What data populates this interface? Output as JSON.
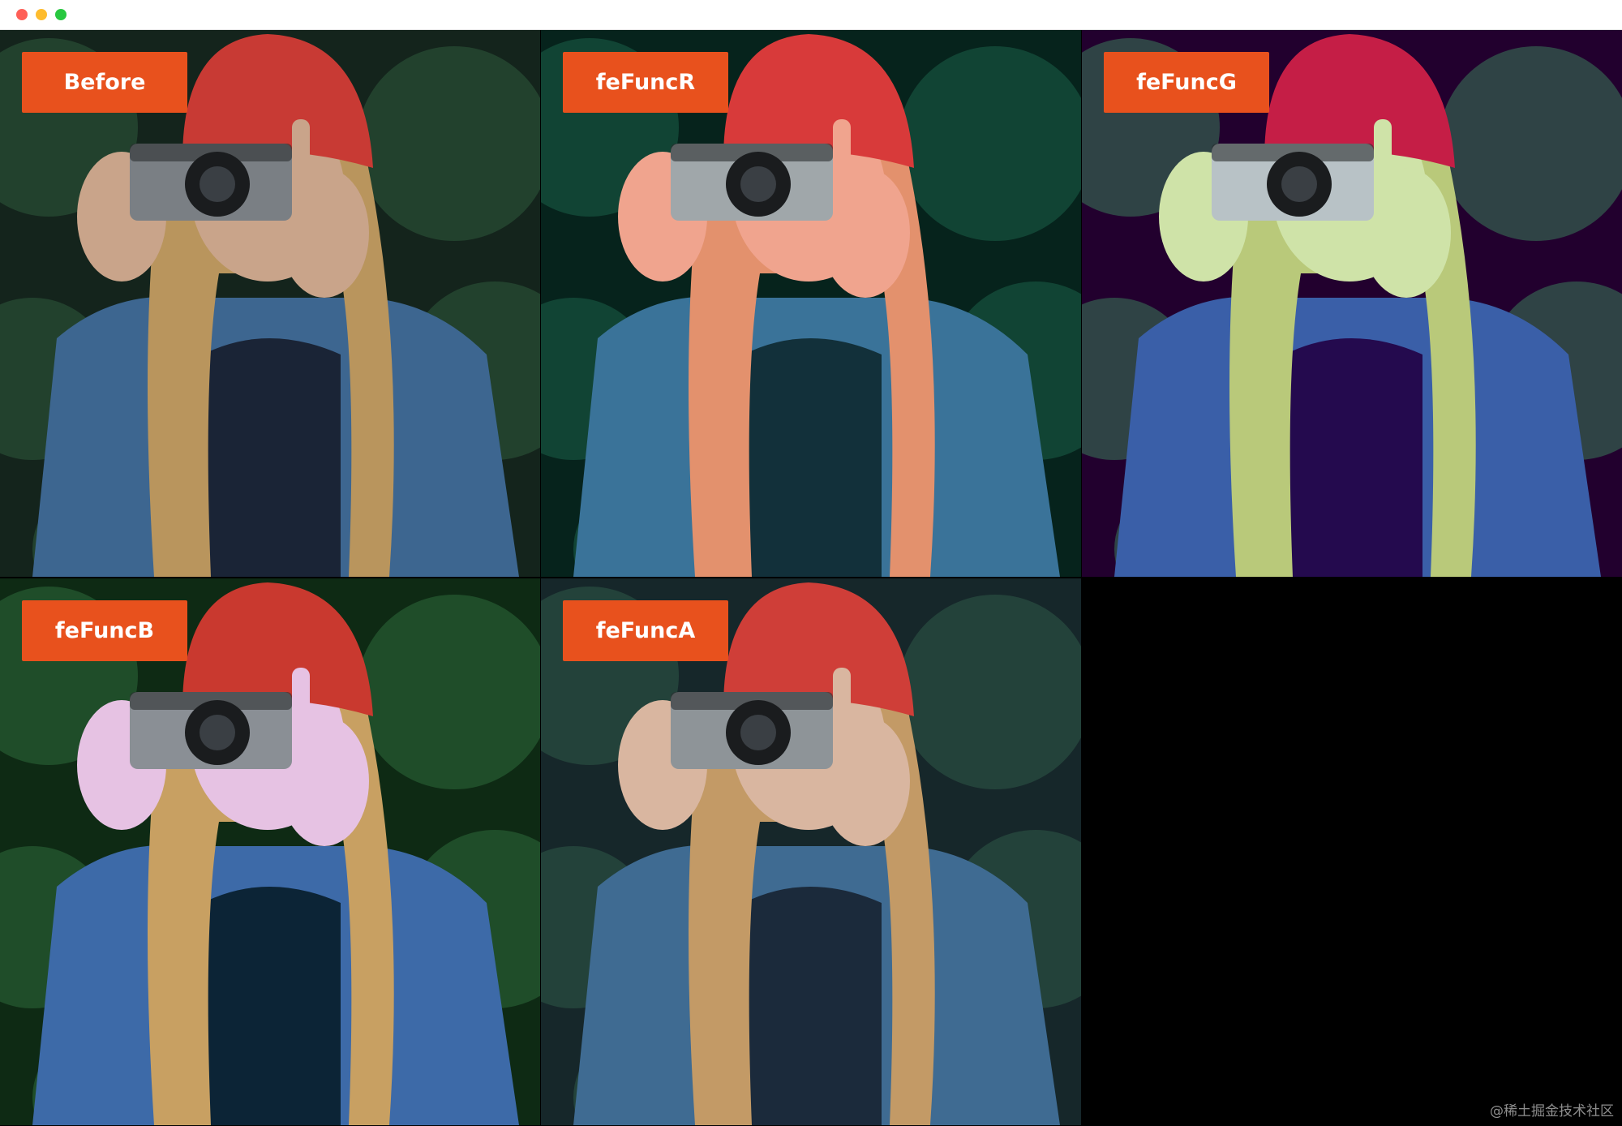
{
  "window": {
    "controls": [
      "close",
      "minimize",
      "maximize"
    ]
  },
  "panels": [
    {
      "label": "Before",
      "colors": {
        "bg": "#14241c",
        "foliage": "#2d5a3c",
        "hat": "#c83a34",
        "skin": "#c9a48a",
        "hair": "#b9955d",
        "shirt": "#1a2436",
        "jacket": "#3d6690",
        "camera": "#7a7f84"
      }
    },
    {
      "label": "feFuncR",
      "colors": {
        "bg": "#06231c",
        "foliage": "#1b6148",
        "hat": "#d83a3a",
        "skin": "#f0a48e",
        "hair": "#e3916d",
        "shirt": "#12303a",
        "jacket": "#3a7399",
        "camera": "#a0a7aa"
      }
    },
    {
      "label": "feFuncG",
      "colors": {
        "bg": "#22002e",
        "foliage": "#3a7a5a",
        "hat": "#c51e46",
        "skin": "#cfe3a8",
        "hair": "#b9c97a",
        "shirt": "#240a4e",
        "jacket": "#3a5fa8",
        "camera": "#b8c2c6"
      }
    },
    {
      "label": "feFuncB",
      "colors": {
        "bg": "#0e2a14",
        "foliage": "#2d6a3a",
        "hat": "#c9392f",
        "skin": "#e6c2e3",
        "hair": "#c8a062",
        "shirt": "#0c2436",
        "jacket": "#3d6aa8",
        "camera": "#8a8f95"
      }
    },
    {
      "label": "feFuncA",
      "colors": {
        "bg": "#16272a",
        "foliage": "#2f5a47",
        "hat": "#cf3e38",
        "skin": "#d9b6a0",
        "hair": "#c39a66",
        "shirt": "#1b2a3b",
        "jacket": "#3f6b92",
        "camera": "#8e9498"
      }
    }
  ],
  "empty_cell_color": "#000000",
  "watermark": "@稀土掘金技术社区"
}
